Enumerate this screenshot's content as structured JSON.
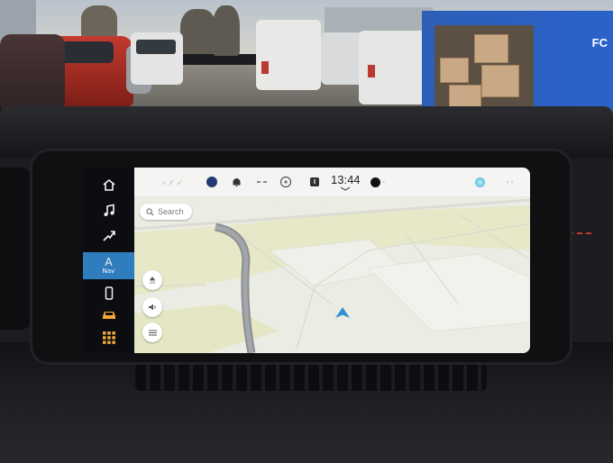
{
  "statusbar": {
    "time": "13:44"
  },
  "rail": {
    "items": [
      {
        "icon": "home-icon"
      },
      {
        "icon": "music-note-icon"
      },
      {
        "icon": "route-arrow-icon"
      },
      {
        "icon": "navigation-arrow-icon",
        "label": "Nav",
        "glyph": "A",
        "active": true
      },
      {
        "icon": "phone-icon"
      },
      {
        "icon": "car-icon"
      },
      {
        "icon": "app-grid-icon"
      }
    ]
  },
  "map": {
    "search_placeholder": "Search",
    "buttons": [
      {
        "icon": "speed-limit-icon",
        "value": "20"
      },
      {
        "icon": "volume-icon"
      },
      {
        "icon": "menu-icon"
      }
    ]
  },
  "truck": {
    "logo": "FC"
  },
  "colors": {
    "active_nav": "#2f7dbc",
    "position_arrow": "#2f8fd8",
    "rail_icons": "#f2f2f2",
    "car_icon": "#f0a63a",
    "grid_icon": "#f0a63a"
  }
}
